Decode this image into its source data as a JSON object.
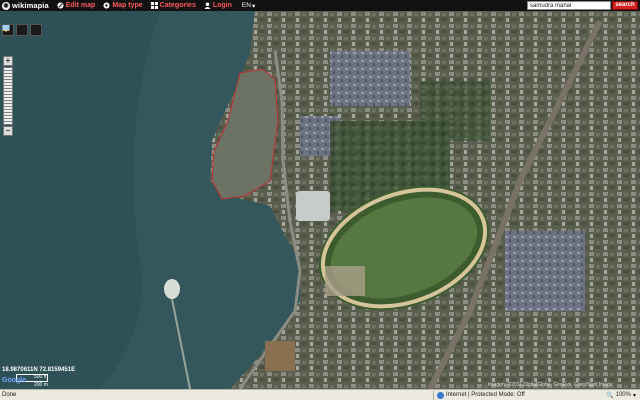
{
  "toolbar": {
    "logo": "wikimapia",
    "menu": [
      {
        "label": "Edit map",
        "icon": "edit-map-icon"
      },
      {
        "label": "Map type",
        "icon": "globe-icon"
      },
      {
        "label": "Categories",
        "icon": "categories-icon"
      },
      {
        "label": "Login",
        "icon": "user-icon"
      }
    ],
    "language": "EN",
    "search_value": "samudra mahal",
    "search_button": "search"
  },
  "map": {
    "coordinates": "18.9870611N 72.8159451E",
    "scale_top": "500 ft",
    "scale_bottom": "200 m",
    "attribution": "Imagery ©2011 DigitalGlobe, GeoEye, Cnes/Spot Image",
    "provider": "Google"
  },
  "statusbar": {
    "status": "Done",
    "zone": "Internet | Protected Mode: Off",
    "zoom": "100%"
  },
  "colors": {
    "toolbar_bg": "#111111",
    "menu_text": "#ff5b5b",
    "search_button": "#d21f1f",
    "water": "#3f6a6e"
  }
}
